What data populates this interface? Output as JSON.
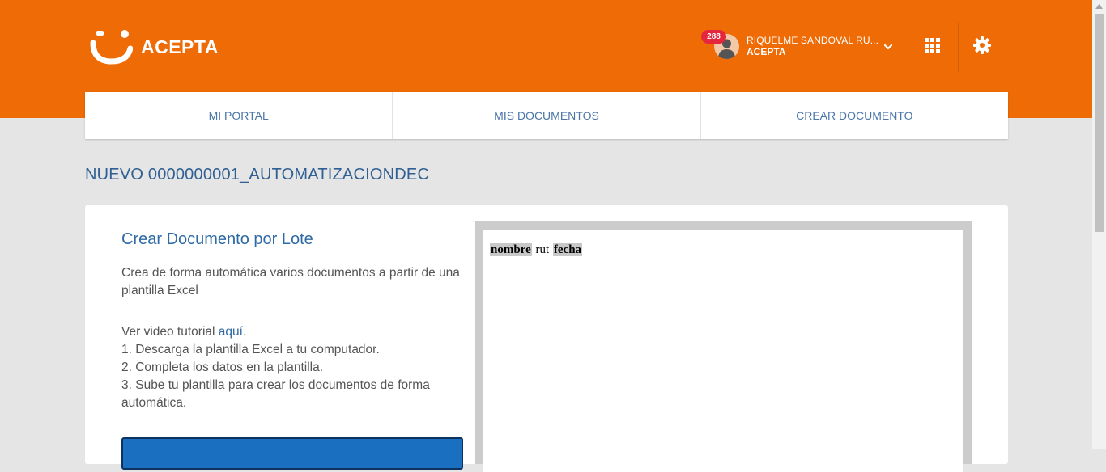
{
  "header": {
    "brand": "ACEPTA",
    "notifications_count": "288",
    "user_name": "RIQUELME SANDOVAL RU...",
    "user_org": "ACEPTA",
    "colors": {
      "primary": "#ee6b06",
      "badge": "#e5273e",
      "link": "#2f6aa5"
    },
    "icons": [
      "acepta-logo-icon",
      "avatar-icon",
      "chevron-down-icon",
      "apps-grid-icon",
      "gear-icon"
    ]
  },
  "nav": {
    "items": [
      {
        "label": "MI PORTAL"
      },
      {
        "label": "MIS DOCUMENTOS"
      },
      {
        "label": "CREAR DOCUMENTO"
      }
    ]
  },
  "page": {
    "title": "NUEVO 0000000001_AUTOMATIZACIONDEC"
  },
  "card": {
    "heading": "Crear Documento por Lote",
    "description": "Crea de forma automática varios documentos a partir de una plantilla Excel",
    "video_prefix": "Ver video tutorial ",
    "video_link": "aquí",
    "video_suffix": ".",
    "steps": [
      "1. Descarga la plantilla Excel a tu computador.",
      "2. Completa los datos en la plantilla.",
      "3. Sube tu plantilla para crear los documentos de forma automática."
    ]
  },
  "preview": {
    "fields": [
      {
        "label": "nombre",
        "highlighted": true
      },
      {
        "label": "rut",
        "highlighted": false
      },
      {
        "label": "fecha",
        "highlighted": true
      }
    ]
  }
}
